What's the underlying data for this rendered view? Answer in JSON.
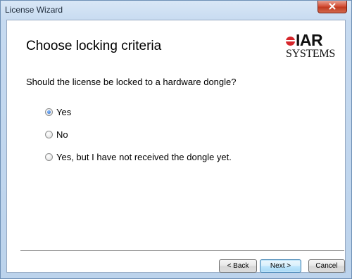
{
  "window": {
    "title": "License Wizard"
  },
  "header": {
    "title": "Choose locking criteria",
    "logo": {
      "line1": "IAR",
      "line2": "SYSTEMS"
    }
  },
  "question": "Should the license be locked to a hardware dongle?",
  "options": [
    {
      "label": "Yes",
      "checked": true
    },
    {
      "label": "No",
      "checked": false
    },
    {
      "label": "Yes, but I have not received the dongle yet.",
      "checked": false
    }
  ],
  "buttons": {
    "back": "< Back",
    "next": "Next >",
    "cancel": "Cancel"
  },
  "colors": {
    "logo_red": "#d6262b",
    "radio_selected": "#1d5fc7"
  },
  "icons": {
    "close": "close-icon",
    "logo_mark": "iar-logo-dot"
  }
}
